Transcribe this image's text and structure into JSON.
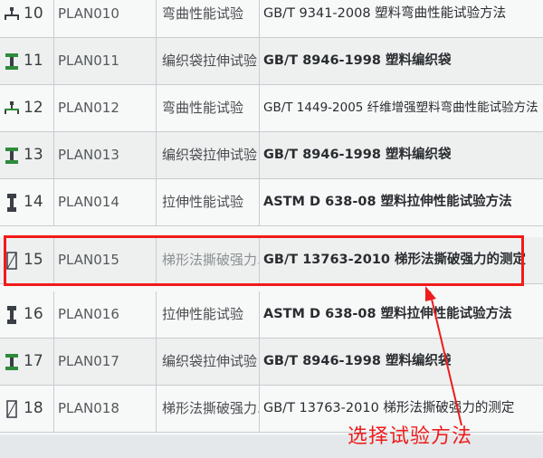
{
  "rows": [
    {
      "num": "10",
      "plan": "PLAN010",
      "test": "弯曲性能试验",
      "method": "GB/T 9341-2008 塑料弯曲性能试验方法",
      "icon": "bend-test-icon"
    },
    {
      "num": "11",
      "plan": "PLAN011",
      "test": "编织袋拉伸试验",
      "method": "GB/T 8946-1998 塑料编织袋",
      "icon": "tensile-grip-icon"
    },
    {
      "num": "12",
      "plan": "PLAN012",
      "test": "弯曲性能试验",
      "method": "GB/T 1449-2005 纤维增强塑料弯曲性能试验方法",
      "icon": "bend-test-icon"
    },
    {
      "num": "13",
      "plan": "PLAN013",
      "test": "编织袋拉伸试验",
      "method": "GB/T 8946-1998 塑料编织袋",
      "icon": "tensile-grip-icon"
    },
    {
      "num": "14",
      "plan": "PLAN014",
      "test": "拉伸性能试验",
      "method": "ASTM D 638-08 塑料拉伸性能试验方法",
      "icon": "dogbone-specimen-icon"
    },
    {
      "num": "15",
      "plan": "PLAN015",
      "test": "梯形法撕破强力...",
      "method": "GB/T 13763-2010 梯形法撕破强力的测定",
      "icon": "tear-specimen-icon"
    },
    {
      "num": "16",
      "plan": "PLAN016",
      "test": "拉伸性能试验",
      "method": "ASTM D 638-08 塑料拉伸性能试验方法",
      "icon": "dogbone-specimen-icon"
    },
    {
      "num": "17",
      "plan": "PLAN017",
      "test": "编织袋拉伸试验",
      "method": "GB/T 8946-1998 塑料编织袋",
      "icon": "tensile-grip-icon"
    },
    {
      "num": "18",
      "plan": "PLAN018",
      "test": "梯形法撕破强力...",
      "method": "GB/T 13763-2010 梯形法撕破强力的测定",
      "icon": "tear-specimen-icon"
    }
  ],
  "annotation": {
    "text": "选择试验方法",
    "color": "#ee1c1c"
  },
  "colors": {
    "highlight": "#f21a1a",
    "icon_green": "#2e8b3a",
    "icon_dark": "#3a3f45"
  }
}
